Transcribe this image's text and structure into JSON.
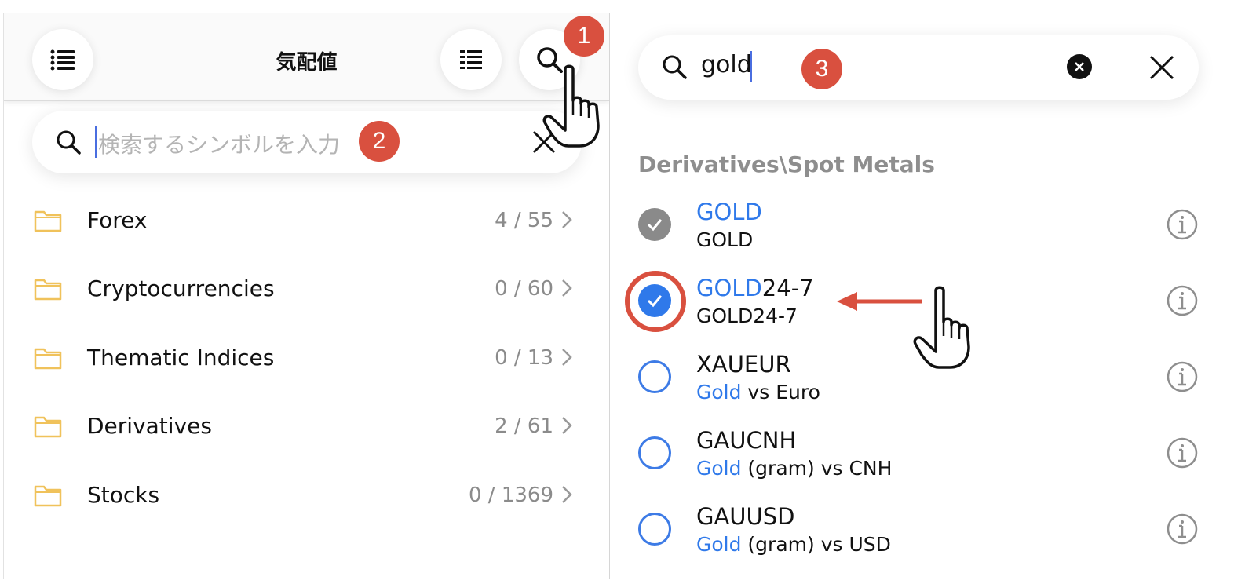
{
  "left": {
    "title": "気配値",
    "search_placeholder": "検索するシンボルを入力",
    "badge_search": "1",
    "badge_input": "2",
    "folders": [
      {
        "label": "Forex",
        "count": "4 / 55"
      },
      {
        "label": "Cryptocurrencies",
        "count": "0 / 60"
      },
      {
        "label": "Thematic Indices",
        "count": "0 / 13"
      },
      {
        "label": "Derivatives",
        "count": "2 / 61"
      },
      {
        "label": "Stocks",
        "count": "0 / 1369"
      }
    ]
  },
  "right": {
    "search_value": "gold",
    "badge_results": "3",
    "section": "Derivatives\\Spot Metals",
    "results": [
      {
        "name_hl": "GOLD",
        "name_rest": "",
        "desc_hl": "",
        "desc_rest": "GOLD",
        "state": "added"
      },
      {
        "name_hl": "GOLD",
        "name_rest": "24-7",
        "desc_hl": "",
        "desc_rest": "GOLD24-7",
        "state": "selected"
      },
      {
        "name_hl": "",
        "name_rest": "XAUEUR",
        "desc_hl": "Gold",
        "desc_rest": " vs Euro",
        "state": "unselected"
      },
      {
        "name_hl": "",
        "name_rest": "GAUCNH",
        "desc_hl": "Gold",
        "desc_rest": " (gram) vs CNH",
        "state": "unselected"
      },
      {
        "name_hl": "",
        "name_rest": "GAUUSD",
        "desc_hl": "Gold",
        "desc_rest": " (gram) vs USD",
        "state": "unselected"
      }
    ]
  },
  "colors": {
    "accent_blue": "#2f79ea",
    "badge_red": "#d9503f",
    "folder_yellow": "#f0c25b",
    "count_gray": "#8b8b8b"
  }
}
